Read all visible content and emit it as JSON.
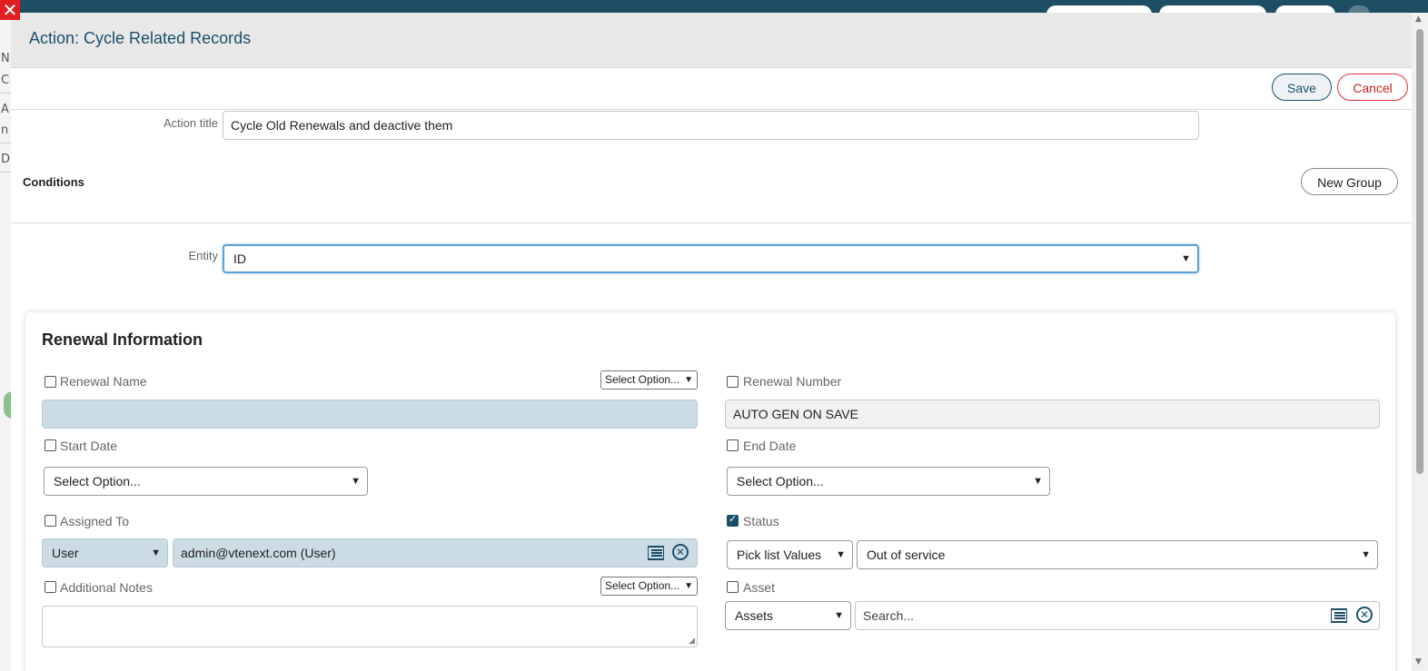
{
  "modal": {
    "title": "Action: Cycle Related Records",
    "save_label": "Save",
    "cancel_label": "Cancel",
    "close_glyph": "✕"
  },
  "action_title": {
    "label": "Action title",
    "value": "Cycle Old Renewals and deactive them"
  },
  "conditions": {
    "label": "Conditions",
    "new_group_label": "New Group"
  },
  "entity": {
    "label": "Entity",
    "value": "ID"
  },
  "background": {
    "left_letters": [
      "N",
      "C",
      "A",
      "n",
      "D"
    ]
  },
  "renewal_info": {
    "title": "Renewal Information",
    "renewal_name": {
      "label": "Renewal Name",
      "checked": false,
      "operator": "Select Option...",
      "value": ""
    },
    "renewal_number": {
      "label": "Renewal Number",
      "checked": false,
      "value": "AUTO GEN ON SAVE"
    },
    "start_date": {
      "label": "Start Date",
      "checked": false,
      "value": "Select Option..."
    },
    "end_date": {
      "label": "End Date",
      "checked": false,
      "value": "Select Option..."
    },
    "assigned_to": {
      "label": "Assigned To",
      "checked": false,
      "type": "User",
      "value": "admin@vtenext.com (User)"
    },
    "status": {
      "label": "Status",
      "checked": true,
      "type": "Pick list Values",
      "value": "Out of service"
    },
    "additional_notes": {
      "label": "Additional Notes",
      "checked": false,
      "operator": "Select Option...",
      "value": ""
    },
    "asset": {
      "label": "Asset",
      "checked": false,
      "module": "Assets",
      "placeholder": "Search..."
    }
  },
  "colors": {
    "accent": "#1b4f6b",
    "cancel": "#e03030",
    "focus": "#5a9fd6",
    "tinted_field": "#ccdce4"
  },
  "icons": {
    "close": "close-icon",
    "chevron": "chevron-down-icon",
    "list": "list-icon",
    "clear": "clear-circle-icon"
  }
}
